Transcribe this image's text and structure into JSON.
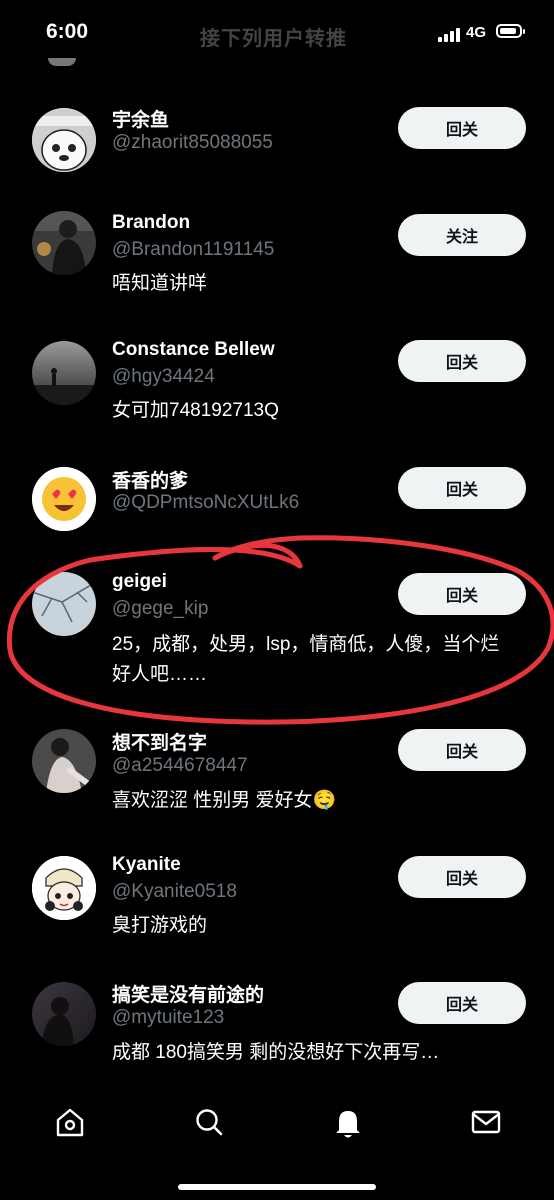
{
  "status_bar": {
    "time": "6:00",
    "faded_title": "接下列用户转推",
    "network": "4G"
  },
  "users": [
    {
      "name": "宇余鱼",
      "handle": "@zhaorit85088055",
      "bio": "",
      "button": "回关",
      "avatar_icon": "bear-cartoon-avatar"
    },
    {
      "name": "Brandon",
      "handle": "@Brandon1191145",
      "bio": "唔知道讲咩",
      "button": "关注",
      "avatar_icon": "person-photo-avatar"
    },
    {
      "name": "Constance Bellew",
      "handle": "@hgy34424",
      "bio": "女可加748192713Q",
      "button": "回关",
      "avatar_icon": "silhouette-photo-avatar"
    },
    {
      "name": "香香的爹",
      "handle": "@QDPmtsoNcXUtLk6",
      "bio": "",
      "button": "回关",
      "avatar_icon": "heart-eyes-emoji-avatar"
    },
    {
      "name": "geigei",
      "handle": "@gege_kip",
      "bio": "25，成都，处男，lsp，情商低，人傻，当个烂好人吧……",
      "button": "回关",
      "avatar_icon": "tree-branch-photo-avatar"
    },
    {
      "name": "想不到名字",
      "handle": "@a2544678447",
      "bio": "喜欢涩涩 性别男 爱好女🤤",
      "button": "回关",
      "avatar_icon": "sitting-person-photo-avatar"
    },
    {
      "name": "Kyanite",
      "handle": "@Kyanite0518",
      "bio": "臭打游戏的",
      "button": "回关",
      "avatar_icon": "anime-character-avatar"
    },
    {
      "name": "搞笑是没有前途的",
      "handle": "@mytuite123",
      "bio": "成都 180搞笑男 剩的没想好下次再写…",
      "button": "回关",
      "avatar_icon": "dusk-profile-photo-avatar"
    }
  ],
  "bottom_nav": [
    {
      "icon": "home-icon"
    },
    {
      "icon": "search-icon"
    },
    {
      "icon": "notifications-bell-icon"
    },
    {
      "icon": "messages-mail-icon"
    }
  ],
  "colors": {
    "background": "#000000",
    "text": "#ffffff",
    "handle": "#6e767d",
    "button_bg": "#eff3f4",
    "button_text": "#0f1419",
    "annotation": "#e8363d"
  }
}
